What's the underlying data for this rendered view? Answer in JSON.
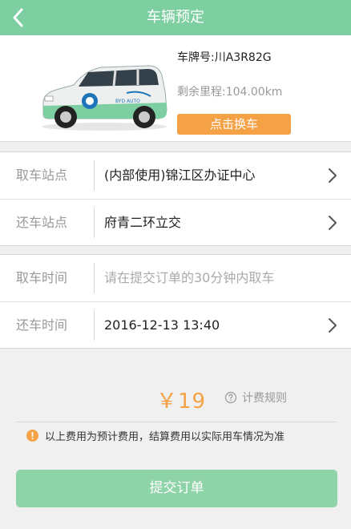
{
  "header": {
    "title": "车辆预定"
  },
  "vehicle": {
    "plate": "车牌号:川A3R82G",
    "mileage": "剩余里程:104.00km",
    "change_label": "点击换车",
    "livery_text": "BYD AUTO"
  },
  "locations": {
    "pickup": {
      "label": "取车站点",
      "value": "(内部使用)锦江区办证中心"
    },
    "return": {
      "label": "还车站点",
      "value": "府青二环立交"
    }
  },
  "times": {
    "pickup": {
      "label": "取车时间",
      "value": "请在提交订单的30分钟内取车"
    },
    "return": {
      "label": "还车时间",
      "value": "2016-12-13 13:40"
    }
  },
  "fee": {
    "price": "￥19",
    "rules_label": "计费规则",
    "notice": "以上费用为预计费用，结算费用以实际用车情况为准"
  },
  "submit_label": "提交订单",
  "colors": {
    "brand_green": "#7dcea0",
    "accent_orange": "#f5a246",
    "submit_green": "#8fd3a9"
  }
}
